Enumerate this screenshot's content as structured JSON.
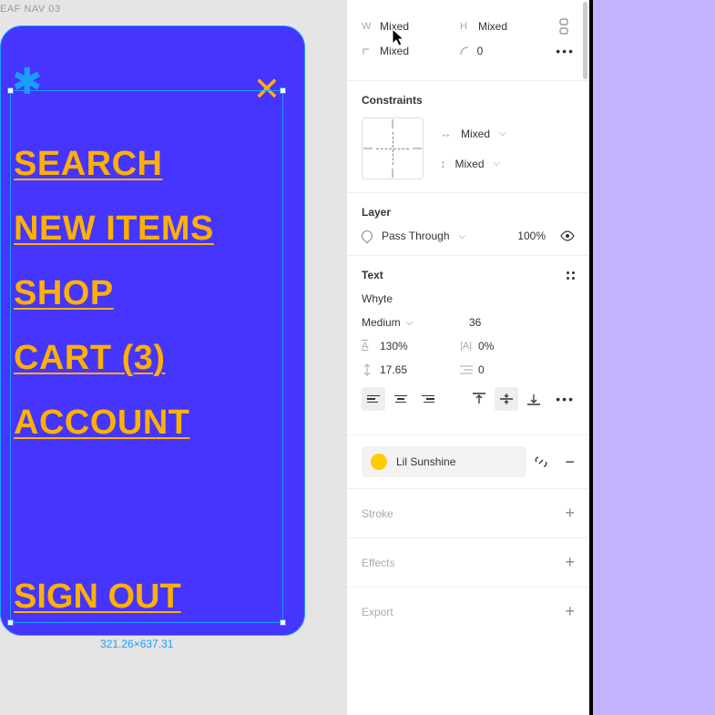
{
  "canvas": {
    "frame_label": "EAF NAV 03",
    "nav_items": [
      "SEARCH",
      "NEW ITEMS",
      "SHOP",
      "CART (3)",
      "ACCOUNT"
    ],
    "sign_out": "SIGN OUT",
    "selection_dimensions": "321.26×637.31"
  },
  "sidebar": {
    "dims": {
      "w_label": "W",
      "w_value": "Mixed",
      "h_label": "H",
      "h_value": "Mixed",
      "rot_value": "Mixed",
      "radius_value": "0"
    },
    "constraints": {
      "title": "Constraints",
      "horizontal": "Mixed",
      "vertical": "Mixed"
    },
    "layer": {
      "title": "Layer",
      "blend_mode": "Pass Through",
      "opacity": "100%"
    },
    "text": {
      "title": "Text",
      "font": "Whyte",
      "weight": "Medium",
      "size": "36",
      "line_height": "130%",
      "letter_spacing": "0%",
      "paragraph_spacing": "17.65",
      "paragraph_indent": "0"
    },
    "fill": {
      "color_name": "Lil Sunshine",
      "color_hex": "#ffcc00"
    },
    "stroke": {
      "title": "Stroke"
    },
    "effects": {
      "title": "Effects"
    },
    "export": {
      "title": "Export"
    }
  }
}
